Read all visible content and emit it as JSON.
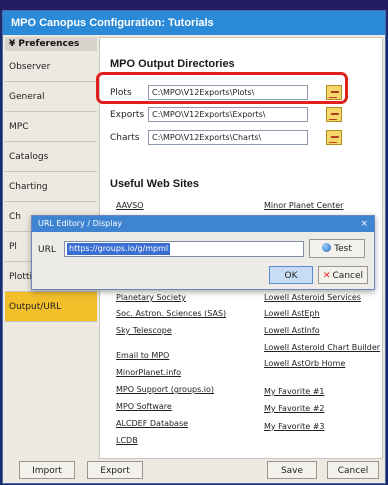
{
  "window": {
    "title": "MPO Canopus Configuration: Tutorials"
  },
  "sidebar": {
    "header": "¥ Preferences",
    "items": [
      {
        "label": "Observer"
      },
      {
        "label": "General"
      },
      {
        "label": "MPC"
      },
      {
        "label": "Catalogs"
      },
      {
        "label": "Charting"
      },
      {
        "label": "Ch"
      },
      {
        "label": "Pl"
      },
      {
        "label": "Plotting"
      },
      {
        "label": "Output/URL"
      }
    ]
  },
  "output_dirs": {
    "title": "MPO Output Directories",
    "rows": [
      {
        "label": "Plots",
        "value": "C:\\MPO\\V12Exports\\Plots\\"
      },
      {
        "label": "Exports",
        "value": "C:\\MPO\\V12Exports\\Exports\\"
      },
      {
        "label": "Charts",
        "value": "C:\\MPO\\V12Exports\\Charts\\"
      }
    ]
  },
  "web": {
    "title": "Useful Web Sites",
    "left_top": [
      "AAVSO"
    ],
    "right_top": [
      "Minor Planet Center"
    ],
    "left_mid": [
      "Planetary Society",
      "Soc. Astron. Sciences (SAS)",
      "Sky Telescope"
    ],
    "right_mid": [
      "Lowell Asteroid Services",
      "Lowell AstEph",
      "Lowell AstInfo",
      "Lowell Asteroid Chart Builder",
      "Lowell AstOrb Home"
    ],
    "left_bottom": [
      "Email to MPO",
      "MinorPlanet.info",
      "MPO Support (groups.io)",
      "MPO Software",
      "ALCDEF Database",
      "LCDB"
    ],
    "right_bottom": [
      "My Favorite #1",
      "My Favorite #2",
      "My Favorite #3"
    ]
  },
  "buttons": {
    "import": "Import",
    "export": "Export",
    "save": "Save",
    "cancel": "Cancel"
  },
  "dialog": {
    "title": "URL Editory / Display",
    "url_label": "URL",
    "url_value": "https://groups.io/g/mpml",
    "test": "Test",
    "ok": "OK",
    "cancel": "Cancel",
    "close": "×"
  },
  "colors": {
    "titlebar": "#2a8ad8",
    "active_tab": "#f2bf2a",
    "highlight": "#e2201b"
  }
}
